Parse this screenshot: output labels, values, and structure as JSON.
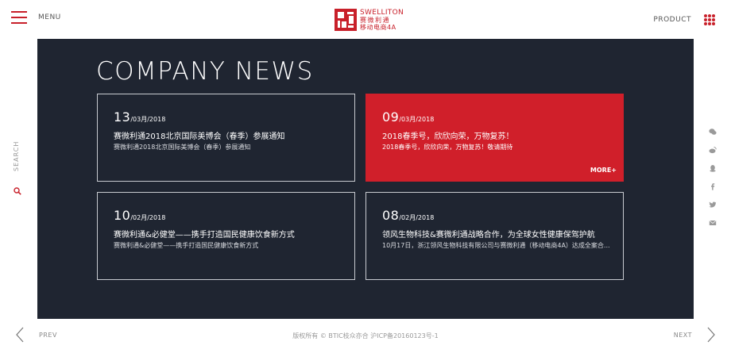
{
  "header": {
    "menu_label": "MENU",
    "logo": {
      "en": "SWELLITON",
      "cn_line1": "赛微利通",
      "cn_line2": "移动电商4A"
    },
    "product_label": "PRODUCT"
  },
  "main": {
    "title": "COMPANY NEWS",
    "news": [
      {
        "day": "13",
        "month": "/03月/2018",
        "title": "赛微利通2018北京国际美博会（春季）参展通知",
        "desc": "赛微利通2018北京国际美博会（春季）参展通知",
        "active": false
      },
      {
        "day": "09",
        "month": "/03月/2018",
        "title": "2018春季号，欣欣向荣，万物复苏！",
        "desc": "2018春季号，欣欣向荣，万物复苏！敬请期待",
        "more": "MORE+",
        "active": true
      },
      {
        "day": "10",
        "month": "/02月/2018",
        "title": "赛微利通&必健堂——携手打造国民健康饮食新方式",
        "desc": "赛微利通&必健堂——携手打造国民健康饮食新方式",
        "active": false
      },
      {
        "day": "08",
        "month": "/02月/2018",
        "title": "领风生物科技&赛微利通战略合作，为全球女性健康保驾护航",
        "desc": "10月17日，浙江领风生物科技有限公司与赛微利通（移动电商4A）达成全案合...",
        "active": false
      }
    ]
  },
  "side": {
    "search_label": "SEARCH",
    "social_icons": [
      "wechat-icon",
      "weibo-icon",
      "qq-icon",
      "facebook-icon",
      "twitter-icon",
      "mail-icon"
    ]
  },
  "footer": {
    "prev_label": "PREV",
    "next_label": "NEXT",
    "copyright": "版权所有 © BTIC枝众亦合  沪ICP备20160123号-1"
  },
  "colors": {
    "accent": "#c8202a",
    "panel": "#1f2531",
    "active_card": "#d01f2a"
  }
}
